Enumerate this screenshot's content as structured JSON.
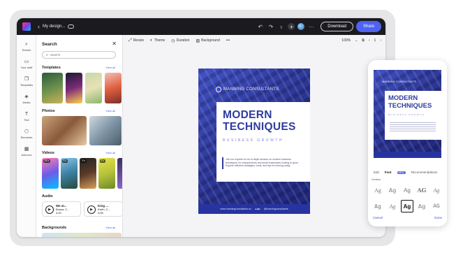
{
  "topbar": {
    "doc_title": "My design...",
    "download_label": "Download",
    "share_label": "Share"
  },
  "rail": {
    "items": [
      {
        "label": "Search",
        "icon": "search-icon"
      },
      {
        "label": "Your stuff",
        "icon": "folder-icon"
      },
      {
        "label": "Templates",
        "icon": "templates-icon"
      },
      {
        "label": "Media",
        "icon": "media-icon"
      },
      {
        "label": "Text",
        "icon": "text-icon"
      },
      {
        "label": "Elements",
        "icon": "elements-icon"
      },
      {
        "label": "Add-ons",
        "icon": "addons-icon"
      }
    ]
  },
  "panel": {
    "title": "Search",
    "search_placeholder": "Search",
    "view_all": "View all",
    "sections": {
      "templates": "Templates",
      "photos": "Photos",
      "videos": "Videos",
      "audio": "Audio",
      "backgrounds": "Backgrounds"
    },
    "video_badges": [
      "25 s",
      "5 s",
      "5 s",
      "5 s"
    ],
    "audio": [
      {
        "title": "We at...",
        "meta": "Bossa, C...",
        "time": "4:20"
      },
      {
        "title": "King ...",
        "meta": "Earth, C...",
        "time": "3:55"
      }
    ]
  },
  "toolbar": {
    "resize": "Resize",
    "theme": "Theme",
    "duration": "Duration",
    "background": "Background",
    "more": "•••",
    "zoom": "100%",
    "page": "1"
  },
  "design": {
    "brand": "MANNING CONSULTANTS",
    "headline_line1": "MODERN",
    "headline_line2": "TECHNIQUES",
    "subheadline": "BUSINESS GROWTH",
    "body": "Join our experts for an in-depth session on modern business techniques for entrepreneurs and small businesses looking to grow. Explore effective strategies, tools, and tips for thriving today.",
    "website": "www.manningconsultants.co",
    "social": "@manningconsultants"
  },
  "phone": {
    "brand": "MANNING CONSULTANTS",
    "headline_line1": "MODERN",
    "headline_line2": "TECHNIQUES",
    "subheadline": "BUSINESS GROWTH",
    "tabs": [
      "Edit",
      "Font",
      "NEW",
      "Recommendations"
    ],
    "section_label": "Combos",
    "font_tiles": [
      "Ag",
      "Ag",
      "Ag",
      "AG",
      "Ag",
      "Ag",
      "Ag",
      "Ag",
      "Ag",
      "AG"
    ],
    "cancel": "Cancel",
    "done": "Done"
  }
}
